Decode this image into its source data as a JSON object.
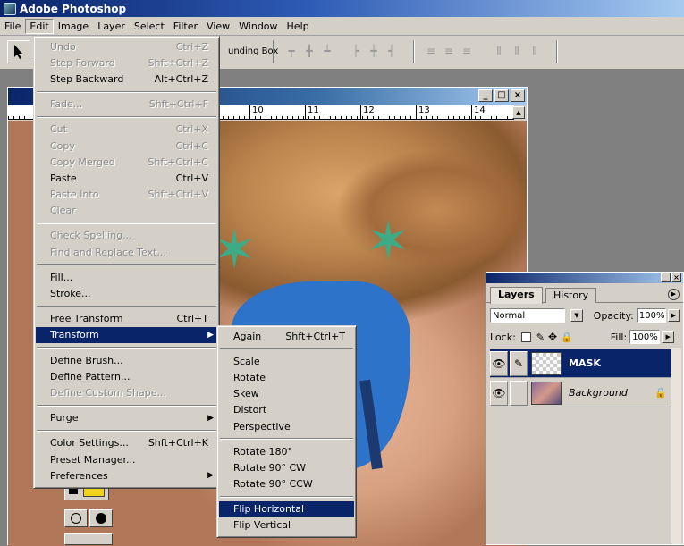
{
  "app": {
    "title": "Adobe Photoshop"
  },
  "menubar": [
    "File",
    "Edit",
    "Image",
    "Layer",
    "Select",
    "Filter",
    "View",
    "Window",
    "Help"
  ],
  "options_bar": {
    "bounding_box_label": "unding Box"
  },
  "ruler": {
    "ticks": [
      "10",
      "11",
      "12",
      "13",
      "14"
    ]
  },
  "edit_menu": {
    "groups": [
      [
        {
          "label": "Undo",
          "shortcut": "Ctrl+Z",
          "disabled": true
        },
        {
          "label": "Step Forward",
          "shortcut": "Shft+Ctrl+Z",
          "disabled": true
        },
        {
          "label": "Step Backward",
          "shortcut": "Alt+Ctrl+Z",
          "disabled": false
        }
      ],
      [
        {
          "label": "Fade...",
          "shortcut": "Shft+Ctrl+F",
          "disabled": true
        }
      ],
      [
        {
          "label": "Cut",
          "shortcut": "Ctrl+X",
          "disabled": true
        },
        {
          "label": "Copy",
          "shortcut": "Ctrl+C",
          "disabled": true
        },
        {
          "label": "Copy Merged",
          "shortcut": "Shft+Ctrl+C",
          "disabled": true
        },
        {
          "label": "Paste",
          "shortcut": "Ctrl+V",
          "disabled": false
        },
        {
          "label": "Paste Into",
          "shortcut": "Shft+Ctrl+V",
          "disabled": true
        },
        {
          "label": "Clear",
          "shortcut": "",
          "disabled": true
        }
      ],
      [
        {
          "label": "Check Spelling...",
          "shortcut": "",
          "disabled": true
        },
        {
          "label": "Find and Replace Text...",
          "shortcut": "",
          "disabled": true
        }
      ],
      [
        {
          "label": "Fill...",
          "shortcut": "",
          "disabled": false
        },
        {
          "label": "Stroke...",
          "shortcut": "",
          "disabled": false
        }
      ],
      [
        {
          "label": "Free Transform",
          "shortcut": "Ctrl+T",
          "disabled": false
        },
        {
          "label": "Transform",
          "shortcut": "",
          "disabled": false,
          "submenu": true,
          "highlighted": true
        }
      ],
      [
        {
          "label": "Define Brush...",
          "shortcut": "",
          "disabled": false
        },
        {
          "label": "Define Pattern...",
          "shortcut": "",
          "disabled": false
        },
        {
          "label": "Define Custom Shape...",
          "shortcut": "",
          "disabled": true
        }
      ],
      [
        {
          "label": "Purge",
          "shortcut": "",
          "disabled": false,
          "submenu": true
        }
      ],
      [
        {
          "label": "Color Settings...",
          "shortcut": "Shft+Ctrl+K",
          "disabled": false
        },
        {
          "label": "Preset Manager...",
          "shortcut": "",
          "disabled": false
        },
        {
          "label": "Preferences",
          "shortcut": "",
          "disabled": false,
          "submenu": true
        }
      ]
    ]
  },
  "transform_menu": {
    "groups": [
      [
        {
          "label": "Again",
          "shortcut": "Shft+Ctrl+T"
        }
      ],
      [
        {
          "label": "Scale",
          "shortcut": ""
        },
        {
          "label": "Rotate",
          "shortcut": ""
        },
        {
          "label": "Skew",
          "shortcut": ""
        },
        {
          "label": "Distort",
          "shortcut": ""
        },
        {
          "label": "Perspective",
          "shortcut": ""
        }
      ],
      [
        {
          "label": "Rotate 180°",
          "shortcut": ""
        },
        {
          "label": "Rotate 90° CW",
          "shortcut": ""
        },
        {
          "label": "Rotate 90° CCW",
          "shortcut": ""
        }
      ],
      [
        {
          "label": "Flip Horizontal",
          "shortcut": "",
          "highlighted": true
        },
        {
          "label": "Flip Vertical",
          "shortcut": ""
        }
      ]
    ]
  },
  "layers_panel": {
    "tabs": [
      "Layers",
      "History"
    ],
    "blend_mode": "Normal",
    "opacity_label": "Opacity:",
    "opacity_value": "100%",
    "lock_label": "Lock:",
    "fill_label": "Fill:",
    "fill_value": "100%",
    "layers": [
      {
        "name": "MASK",
        "selected": true
      },
      {
        "name": "Background",
        "selected": false,
        "locked": true
      }
    ]
  },
  "colors": {
    "title_active": "#0a246a",
    "menu_bg": "#d4d0c8",
    "highlight": "#0a246a"
  }
}
